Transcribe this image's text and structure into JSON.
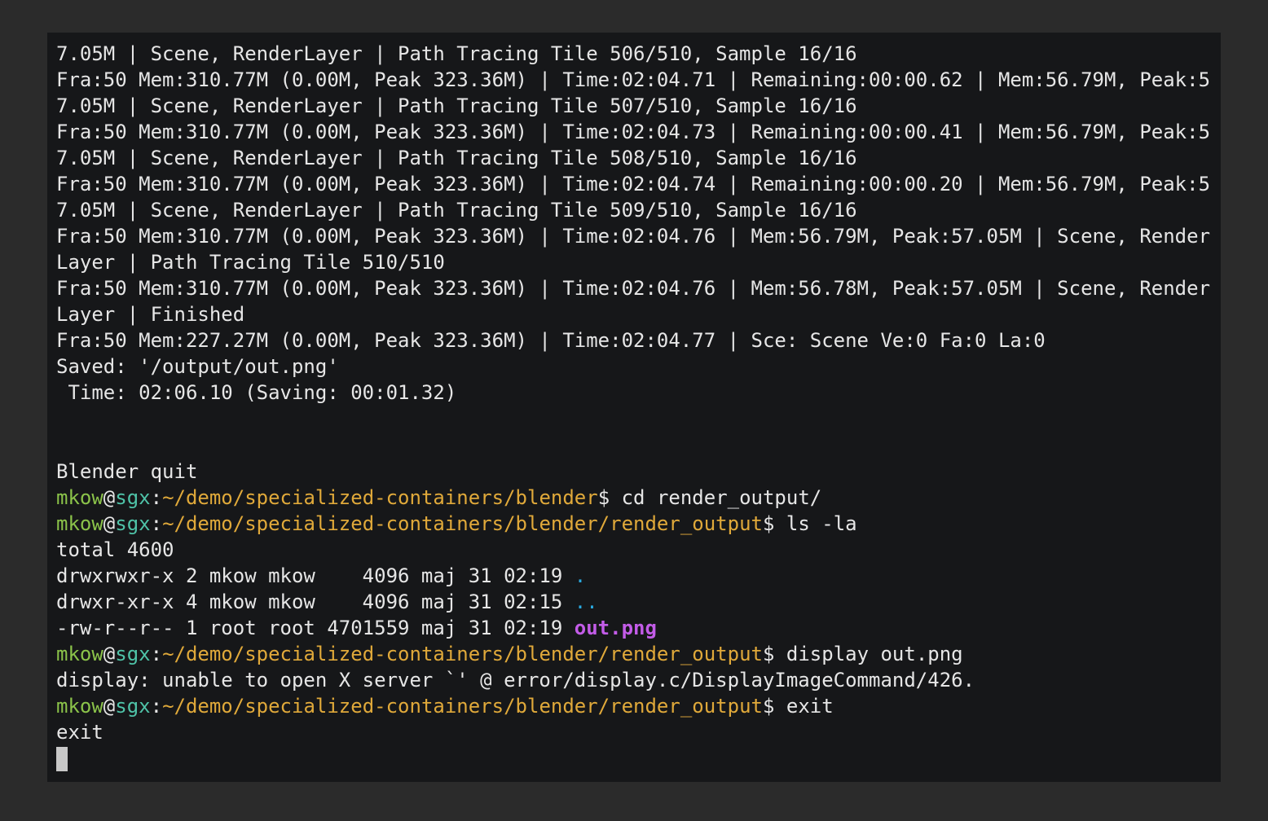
{
  "colors": {
    "background": "#2b2b2b",
    "terminal_bg": "#161719",
    "text": "#e6e6e6",
    "user": "#8bc34a",
    "host": "#4fc3a8",
    "path": "#e0a93a",
    "directory": "#2aa9e0",
    "image_file": "#c35ce8",
    "cursor": "#c8c8c8"
  },
  "output_lines": [
    "7.05M | Scene, RenderLayer | Path Tracing Tile 506/510, Sample 16/16",
    "Fra:50 Mem:310.77M (0.00M, Peak 323.36M) | Time:02:04.71 | Remaining:00:00.62 | Mem:56.79M, Peak:5",
    "7.05M | Scene, RenderLayer | Path Tracing Tile 507/510, Sample 16/16",
    "Fra:50 Mem:310.77M (0.00M, Peak 323.36M) | Time:02:04.73 | Remaining:00:00.41 | Mem:56.79M, Peak:5",
    "7.05M | Scene, RenderLayer | Path Tracing Tile 508/510, Sample 16/16",
    "Fra:50 Mem:310.77M (0.00M, Peak 323.36M) | Time:02:04.74 | Remaining:00:00.20 | Mem:56.79M, Peak:5",
    "7.05M | Scene, RenderLayer | Path Tracing Tile 509/510, Sample 16/16",
    "Fra:50 Mem:310.77M (0.00M, Peak 323.36M) | Time:02:04.76 | Mem:56.79M, Peak:57.05M | Scene, Render",
    "Layer | Path Tracing Tile 510/510",
    "Fra:50 Mem:310.77M (0.00M, Peak 323.36M) | Time:02:04.76 | Mem:56.78M, Peak:57.05M | Scene, Render",
    "Layer | Finished",
    "Fra:50 Mem:227.27M (0.00M, Peak 323.36M) | Time:02:04.77 | Sce: Scene Ve:0 Fa:0 La:0",
    "Saved: '/output/out.png'",
    " Time: 02:06.10 (Saving: 00:01.32)"
  ],
  "quit_message": "Blender quit",
  "prompt": {
    "user": "mkow",
    "at": "@",
    "host": "sgx",
    "colon": ":",
    "dollar": "$ ",
    "path_blender": "~/demo/specialized-containers/blender",
    "path_render_output": "~/demo/specialized-containers/blender/render_output"
  },
  "commands": {
    "cd": "cd render_output/",
    "ls": "ls -la",
    "display": "display out.png",
    "exit": "exit"
  },
  "ls_output": {
    "total": "total 4600",
    "rows": [
      {
        "meta": "drwxrwxr-x 2 mkow mkow    4096 maj 31 02:19 ",
        "name": "."
      },
      {
        "meta": "drwxr-xr-x 4 mkow mkow    4096 maj 31 02:15 ",
        "name": ".."
      },
      {
        "meta": "-rw-r--r-- 1 root root 4701559 maj 31 02:19 ",
        "name": "out.png"
      }
    ]
  },
  "display_error": "display: unable to open X server `' @ error/display.c/DisplayImageCommand/426.",
  "exit_output": "exit"
}
